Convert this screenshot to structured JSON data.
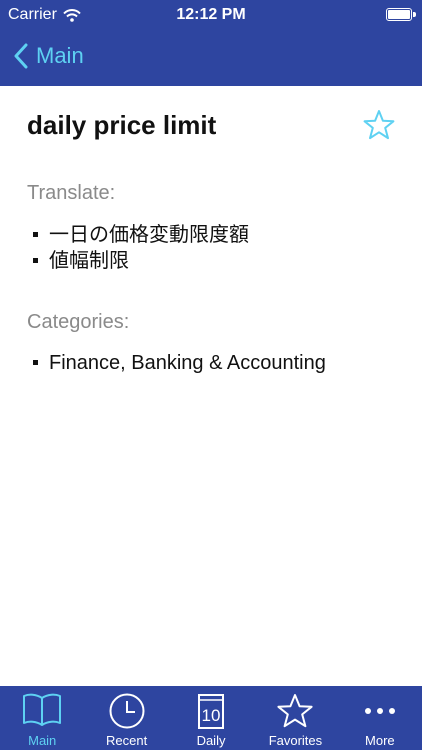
{
  "status_bar": {
    "carrier": "Carrier",
    "time": "12:12 PM"
  },
  "nav": {
    "back_label": "Main"
  },
  "entry": {
    "term": "daily price limit",
    "translate_heading": "Translate:",
    "translations": [
      "一日の価格変動限度額",
      "値幅制限"
    ],
    "categories_heading": "Categories:",
    "categories": [
      "Finance, Banking & Accounting"
    ]
  },
  "tabs": [
    {
      "label": "Main",
      "icon": "book-icon",
      "active": true
    },
    {
      "label": "Recent",
      "icon": "clock-icon",
      "active": false
    },
    {
      "label": "Daily",
      "icon": "calendar-icon",
      "badge": "10",
      "active": false
    },
    {
      "label": "Favorites",
      "icon": "star-icon",
      "active": false
    },
    {
      "label": "More",
      "icon": "more-icon",
      "active": false
    }
  ],
  "colors": {
    "bar": "#2E45A0",
    "accent": "#5ED1F2",
    "text": "#111111",
    "muted": "#8a8a8a"
  }
}
